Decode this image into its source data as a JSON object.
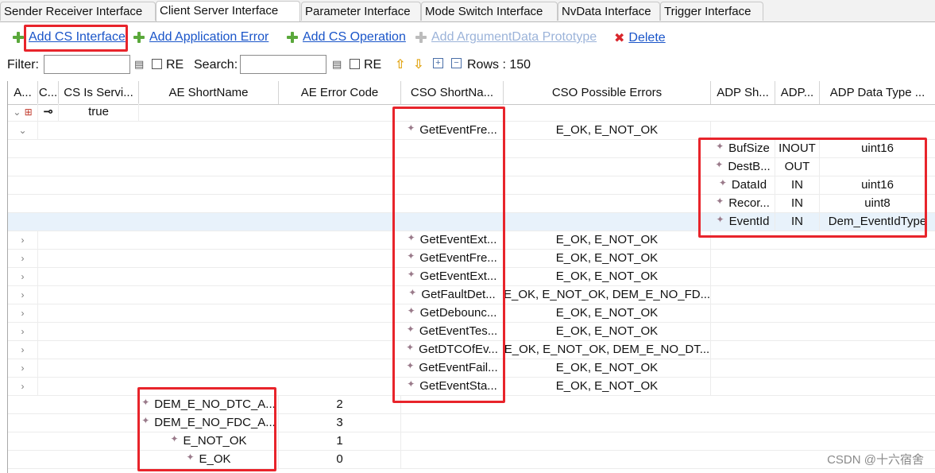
{
  "tabs": [
    {
      "label": "Sender Receiver Interface",
      "active": false
    },
    {
      "label": "Client Server Interface",
      "active": true
    },
    {
      "label": "Parameter Interface",
      "active": false
    },
    {
      "label": "Mode Switch Interface",
      "active": false
    },
    {
      "label": "NvData Interface",
      "active": false
    },
    {
      "label": "Trigger Interface",
      "active": false
    }
  ],
  "toolbar": {
    "add_cs_interface": "Add CS Interface",
    "add_application_error": "Add Application Error",
    "add_cs_operation": "Add CS Operation",
    "add_argumentdata_prototype": "Add ArgumentData Prototype",
    "delete": "Delete"
  },
  "filter": {
    "filter_label": "Filter:",
    "re_label": "RE",
    "search_label": "Search:",
    "search_re_label": "RE",
    "rows_label": "Rows : 150"
  },
  "table": {
    "columns": [
      "A...",
      "C...",
      "CS Is Servi...",
      "AE ShortName",
      "AE Error Code",
      "CSO ShortNa...",
      "CSO Possible Errors",
      "ADP Sh...",
      "ADP...",
      "ADP Data Type ..."
    ],
    "interface_row": {
      "cs_is_service": "true"
    },
    "operations_expanded": {
      "name": "GetEventFre...",
      "errors": "E_OK, E_NOT_OK"
    },
    "arguments": [
      {
        "name": "BufSize",
        "direction": "INOUT",
        "type": "uint16"
      },
      {
        "name": "DestB...",
        "direction": "OUT",
        "type": ""
      },
      {
        "name": "DataId",
        "direction": "IN",
        "type": "uint16"
      },
      {
        "name": "Recor...",
        "direction": "IN",
        "type": "uint8"
      },
      {
        "name": "EventId",
        "direction": "IN",
        "type": "Dem_EventIdType"
      }
    ],
    "operations": [
      {
        "name": "GetEventExt...",
        "errors": "E_OK, E_NOT_OK"
      },
      {
        "name": "GetEventFre...",
        "errors": "E_OK, E_NOT_OK"
      },
      {
        "name": "GetEventExt...",
        "errors": "E_OK, E_NOT_OK"
      },
      {
        "name": "GetFaultDet...",
        "errors": "E_OK, E_NOT_OK, DEM_E_NO_FD..."
      },
      {
        "name": "GetDebounc...",
        "errors": "E_OK, E_NOT_OK"
      },
      {
        "name": "GetEventTes...",
        "errors": "E_OK, E_NOT_OK"
      },
      {
        "name": "GetDTCOfEv...",
        "errors": "E_OK, E_NOT_OK, DEM_E_NO_DT..."
      },
      {
        "name": "GetEventFail...",
        "errors": "E_OK, E_NOT_OK"
      },
      {
        "name": "GetEventSta...",
        "errors": "E_OK, E_NOT_OK"
      }
    ],
    "app_errors": [
      {
        "name": "DEM_E_NO_DTC_A...",
        "code": "2"
      },
      {
        "name": "DEM_E_NO_FDC_A...",
        "code": "3"
      },
      {
        "name": "E_NOT_OK",
        "code": "1"
      },
      {
        "name": "E_OK",
        "code": "0"
      }
    ]
  },
  "watermark": "CSDN @十六宿舍",
  "colors": {
    "accent_link": "#1a55c9",
    "highlight_box": "#e8242b",
    "plus_green": "#5aa83b"
  }
}
